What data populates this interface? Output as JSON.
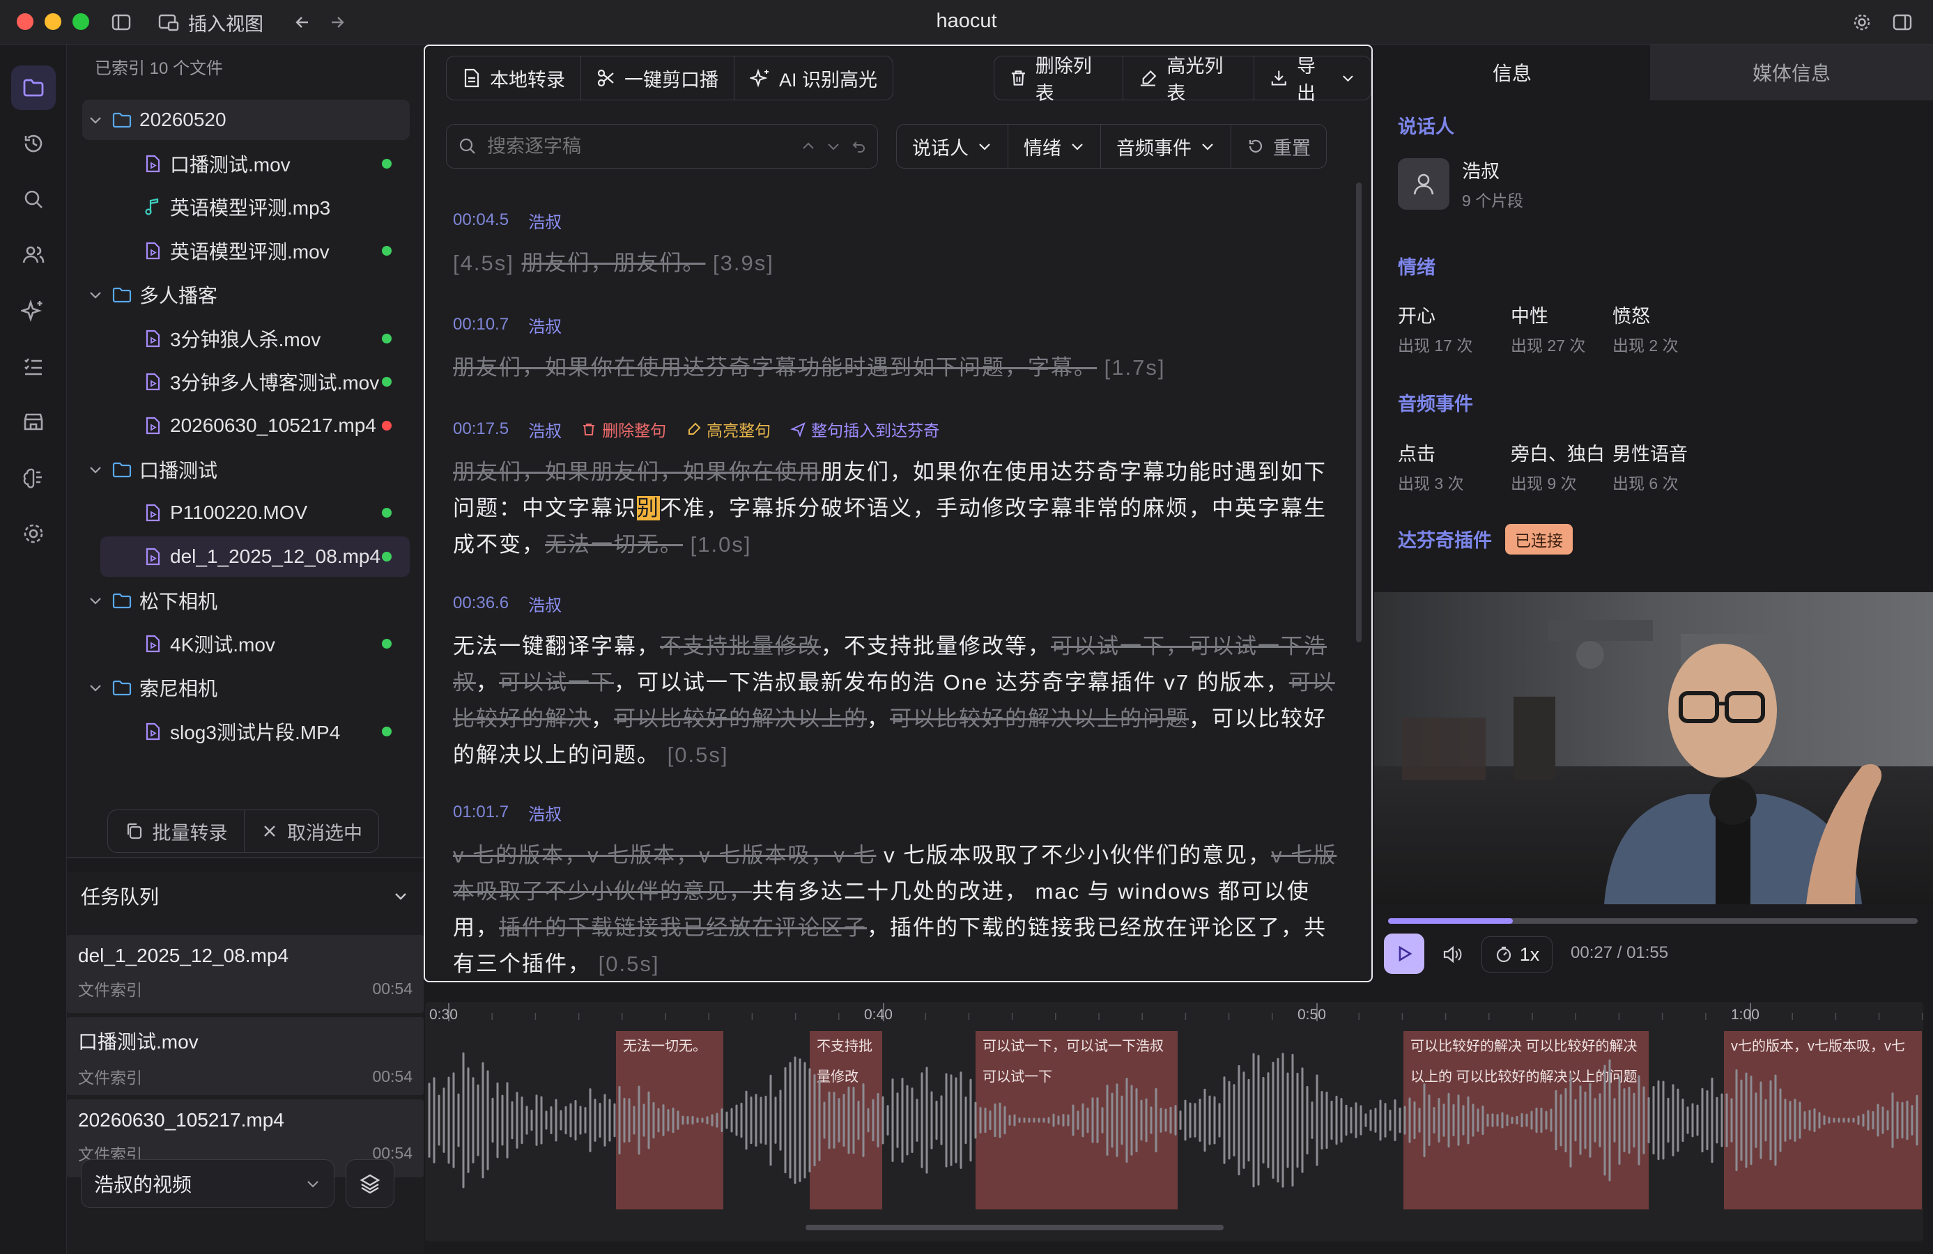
{
  "app": {
    "title": "haocut",
    "insert_view": "插入视图"
  },
  "tree": {
    "indexed": "已索引 10 个文件",
    "items": [
      {
        "type": "folder",
        "name": "20260520",
        "depth": 0,
        "expanded": true,
        "highlight": true
      },
      {
        "type": "video",
        "name": "口播测试.mov",
        "depth": 1,
        "status": "green"
      },
      {
        "type": "audio",
        "name": "英语模型评测.mp3",
        "depth": 1,
        "status": ""
      },
      {
        "type": "video",
        "name": "英语模型评测.mov",
        "depth": 1,
        "status": "green"
      },
      {
        "type": "folder",
        "name": "多人播客",
        "depth": 0,
        "expanded": true
      },
      {
        "type": "video",
        "name": "3分钟狼人杀.mov",
        "depth": 1,
        "status": "green"
      },
      {
        "type": "video",
        "name": "3分钟多人博客测试.mov",
        "depth": 1,
        "status": "green"
      },
      {
        "type": "video",
        "name": "20260630_105217.mp4",
        "depth": 1,
        "status": "red"
      },
      {
        "type": "folder",
        "name": "口播测试",
        "depth": 0,
        "expanded": true
      },
      {
        "type": "video",
        "name": "P1100220.MOV",
        "depth": 1,
        "status": "green"
      },
      {
        "type": "video",
        "name": "del_1_2025_12_08.mp4",
        "depth": 1,
        "status": "green",
        "selected": true
      },
      {
        "type": "folder",
        "name": "松下相机",
        "depth": 0,
        "expanded": true
      },
      {
        "type": "video",
        "name": "4K测试.mov",
        "depth": 1,
        "status": "green"
      },
      {
        "type": "folder",
        "name": "索尼相机",
        "depth": 0,
        "expanded": true
      },
      {
        "type": "video",
        "name": "slog3测试片段.MP4",
        "depth": 1,
        "status": "green"
      }
    ],
    "batch_label": "批量转录",
    "cancel_label": "取消选中"
  },
  "queue": {
    "title": "任务队列",
    "items": [
      {
        "name": "del_1_2025_12_08.mp4",
        "type": "文件索引",
        "duration": "00:54"
      },
      {
        "name": "口播测试.mov",
        "type": "文件索引",
        "duration": "00:54"
      },
      {
        "name": "20260630_105217.mp4",
        "type": "文件索引",
        "duration": "00:54"
      }
    ],
    "workspace": "浩叔的视频"
  },
  "toolbar": {
    "local": "本地转录",
    "oneclick": "一键剪口播",
    "ai": "AI 识别高光",
    "dellist": "删除列表",
    "hllist": "高光列表",
    "export": "导出"
  },
  "filter": {
    "search_placeholder": "搜索逐字稿",
    "speaker": "说话人",
    "emotion": "情绪",
    "audio_event": "音频事件",
    "reset": "重置"
  },
  "transcript": [
    {
      "time": "00:04.5",
      "speaker": "浩叔",
      "parts": [
        [
          "br",
          "[4.5s] "
        ],
        [
          "del",
          "朋友们，朋友们。"
        ],
        [
          "br",
          " [3.9s]"
        ]
      ]
    },
    {
      "time": "00:10.7",
      "speaker": "浩叔",
      "parts": [
        [
          "del",
          "朋友们，如果你在使用达芬奇字幕功能时遇到如下问题，字幕。"
        ],
        [
          "br",
          " [1.7s]"
        ]
      ]
    },
    {
      "time": "00:17.5",
      "speaker": "浩叔",
      "actions": [
        "删除整句",
        "高亮整句",
        "整句插入到达芬奇"
      ],
      "parts": [
        [
          "del",
          "朋友们，如果朋友们，如果你在使用"
        ],
        [
          "n",
          "朋友们，如果你在使用达芬奇字幕功能时遇到如下问题：中文字幕识"
        ],
        [
          "hl",
          "别"
        ],
        [
          "n",
          "不准，字幕拆分破坏语义，手动修改字幕非常的麻烦，中英字幕生成不变，"
        ],
        [
          "del",
          "无法一切无。"
        ],
        [
          "br",
          " [1.0s]"
        ]
      ]
    },
    {
      "time": "00:36.6",
      "speaker": "浩叔",
      "parts": [
        [
          "n",
          "无法一键翻译字幕，"
        ],
        [
          "del",
          "不支持批量修改"
        ],
        [
          "n",
          "，不支持批量修改等，"
        ],
        [
          "del",
          "可以试一下，可以试一下浩叔"
        ],
        [
          "n",
          "，"
        ],
        [
          "del",
          "可以试一下"
        ],
        [
          "n",
          "，可以试一下浩叔最新发布的浩 One 达芬奇字幕插件 v7 的版本，"
        ],
        [
          "del",
          "可以比较好的解决"
        ],
        [
          "n",
          "，"
        ],
        [
          "del",
          "可以比较好的解决以上的"
        ],
        [
          "n",
          "，"
        ],
        [
          "del",
          "可以比较好的解决以上的问题"
        ],
        [
          "n",
          "，可以比较好的解决以上的问题。"
        ],
        [
          "br",
          " [0.5s]"
        ]
      ]
    },
    {
      "time": "01:01.7",
      "speaker": "浩叔",
      "parts": [
        [
          "del",
          "v 七的版本，v 七版本，v 七版本吸，v 七"
        ],
        [
          "n",
          " v 七版本吸取了不少小伙伴们的意见，"
        ],
        [
          "del",
          "v 七版本吸取了不少小伙伴的意见，"
        ],
        [
          "n",
          "共有多达二十几处的改进， mac 与 windows 都可以使用，"
        ],
        [
          "del",
          "插件的下载链接我已经放在评论区子"
        ],
        [
          "n",
          "，插件的下载的链接我已经放在评论区了，共有三个插件，"
        ],
        [
          "br",
          " [0.5s]"
        ]
      ]
    }
  ],
  "info": {
    "tab_info": "信息",
    "tab_media": "媒体信息",
    "speaker_title": "说话人",
    "speaker_name": "浩叔",
    "speaker_sub": "9 个片段",
    "emotion_title": "情绪",
    "emotions": [
      {
        "name": "开心",
        "sub": "出现 17 次"
      },
      {
        "name": "中性",
        "sub": "出现 27 次"
      },
      {
        "name": "愤怒",
        "sub": "出现 2 次"
      }
    ],
    "event_title": "音频事件",
    "events": [
      {
        "name": "点击",
        "sub": "出现 3 次"
      },
      {
        "name": "旁白、独白",
        "sub": "出现 9 次"
      },
      {
        "name": "男性语音",
        "sub": "出现 6 次"
      }
    ],
    "plugin_title": "达芬奇插件",
    "plugin_status": "已连接"
  },
  "player": {
    "speed": "1x",
    "time": "00:27 / 01:55",
    "progress": 0.235
  },
  "timeline": {
    "ticks": [
      "0:30",
      "0:40",
      "0:50",
      "1:00"
    ],
    "regions": [
      {
        "label": "无法一切无。"
      },
      {
        "label": "不支持批量修改"
      },
      {
        "label": "可以试一下，可以试一下浩叔 可以试一下"
      },
      {
        "label": "可以比较好的解决 可以比较好的解决以上的 可以比较好的解决以上的问题"
      },
      {
        "label": "v七的版本，v七版本吸，v七"
      }
    ]
  },
  "colors": {
    "accent": "#9f8cff",
    "deleted_region": "#6e3b3c",
    "status_green": "#3ccf5e",
    "status_red": "#ff4d4d"
  }
}
